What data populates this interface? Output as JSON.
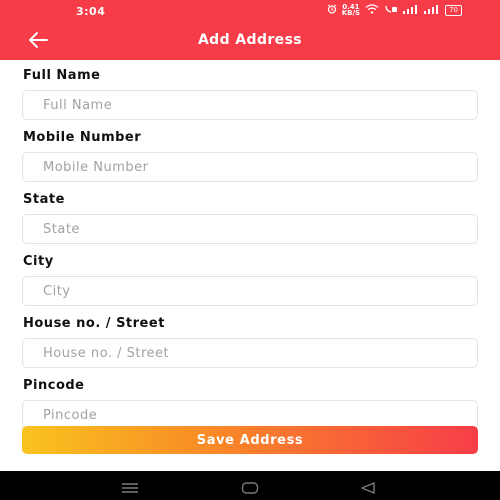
{
  "status_bar": {
    "time": "3:04",
    "speed_value": "0.41",
    "speed_unit": "KB/S",
    "battery": "70",
    "icons": [
      "alarm-icon",
      "wifi-icon",
      "volte-icon",
      "signal-icon",
      "signal-icon",
      "battery-icon"
    ]
  },
  "header": {
    "title": "Add Address",
    "back_icon": "arrow-left-icon",
    "background": "#f63c48"
  },
  "form": {
    "fields": [
      {
        "label": "Full Name",
        "placeholder": "Full Name",
        "value": ""
      },
      {
        "label": "Mobile Number",
        "placeholder": "Mobile Number",
        "value": ""
      },
      {
        "label": "State",
        "placeholder": "State",
        "value": ""
      },
      {
        "label": "City",
        "placeholder": "City",
        "value": ""
      },
      {
        "label": "House no. / Street",
        "placeholder": "House no. / Street",
        "value": ""
      },
      {
        "label": "Pincode",
        "placeholder": "Pincode",
        "value": ""
      }
    ],
    "submit_label": "Save Address",
    "submit_gradient": [
      "#f9c31f",
      "#f73d48"
    ]
  },
  "nav_bar": {
    "icons": [
      "menu-icon",
      "home-icon",
      "back-triangle-icon"
    ]
  }
}
